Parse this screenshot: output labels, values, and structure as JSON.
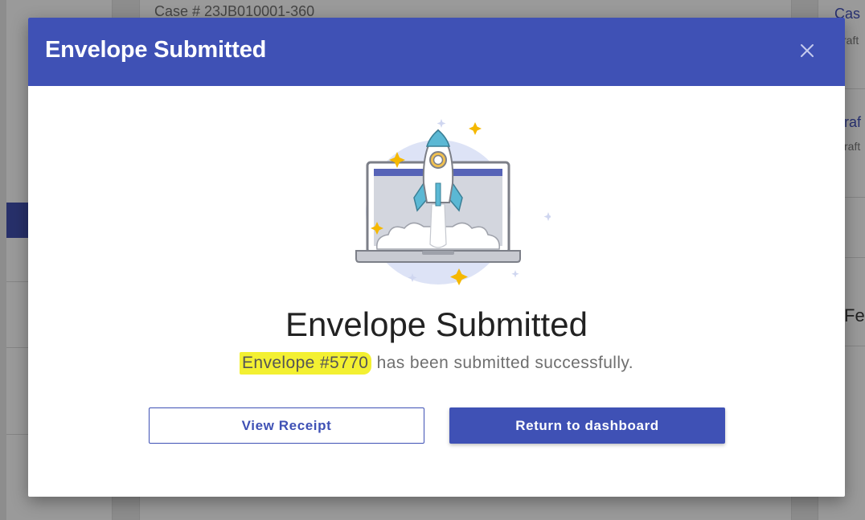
{
  "background": {
    "case_top": "Case # 23JB010001-360",
    "right_1": "Cas",
    "right_2": "raft",
    "right_3": "raf",
    "right_4": "raft",
    "right_5": "Fer"
  },
  "modal": {
    "title": "Envelope Submitted",
    "close_icon": "close-icon",
    "illustration": "rocket-launch-laptop",
    "headline": "Envelope Submitted",
    "envelope_ref": "Envelope #5770",
    "message_rest": " has been submitted successfully.",
    "view_receipt_label": "View Receipt",
    "return_label": "Return to dashboard"
  },
  "colors": {
    "primary": "#3f51b5",
    "highlight": "#f3f032",
    "accent_star": "#f5b800",
    "rocket_blue": "#5bb8d4"
  }
}
